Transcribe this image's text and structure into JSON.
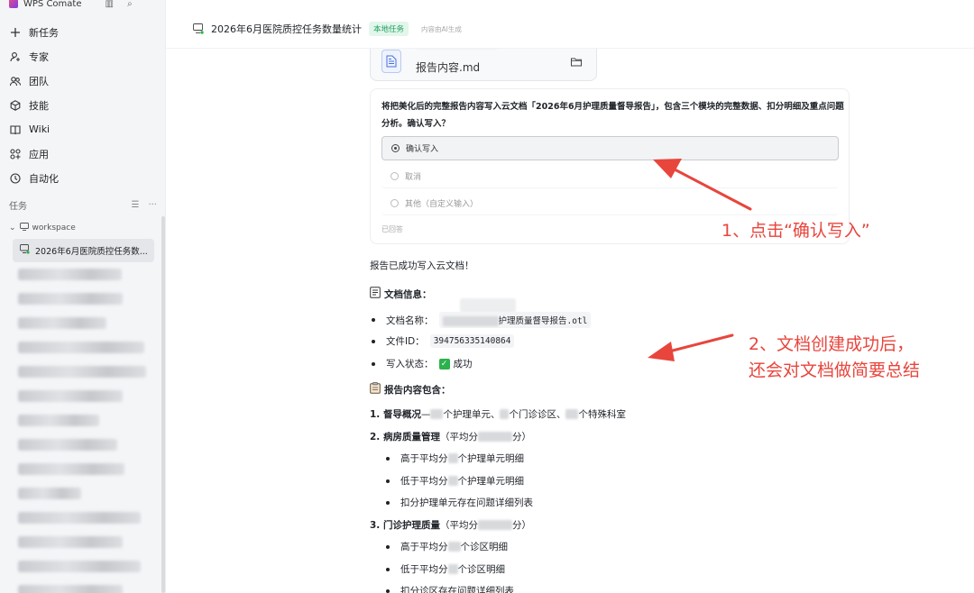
{
  "app": {
    "title": "WPS Comate"
  },
  "sidebar": {
    "nav": [
      {
        "icon": "plus-icon",
        "label": "新任务"
      },
      {
        "icon": "expert-icon",
        "label": "专家"
      },
      {
        "icon": "team-icon",
        "label": "团队"
      },
      {
        "icon": "skill-icon",
        "label": "技能"
      },
      {
        "icon": "wiki-icon",
        "label": "Wiki"
      },
      {
        "icon": "apps-icon",
        "label": "应用"
      },
      {
        "icon": "clock-icon",
        "label": "自动化"
      }
    ],
    "tasks_label": "任务",
    "workspace_label": "workspace",
    "active_task": "2026年6月医院质控任务数..."
  },
  "header": {
    "title": "2026年6月医院质控任务数量统计",
    "badge": "本地任务",
    "ai_note": "内容由AI生成"
  },
  "file_card": {
    "name": "报告内容.md"
  },
  "ask": {
    "question": "将把美化后的完整报告内容写入云文档「2026年6月护理质量督导报告」，包含三个模块的完整数据、扣分明细及重点问题分析。确认写入？",
    "options": [
      "确认写入",
      "取消",
      "其他（自定义输入）"
    ],
    "answered": "已回答"
  },
  "result": {
    "success": "报告已成功写入云文档！",
    "doc_info_title": "文档信息：",
    "doc_name_label": "文档名称：",
    "doc_name_value": "护理质量督导报告.otl",
    "file_id_label": "文件ID：",
    "file_id_value": "394756335140864",
    "status_label": "写入状态：",
    "status_value": "成功",
    "contains_title": "报告内容包含：",
    "item1_title": "1. 督导概况",
    "item1_text_a": " — ",
    "item1_text_b": "个护理单元、",
    "item1_text_c": "个门诊诊区、",
    "item1_text_d": "个特殊科室",
    "item2_title": "2. 病房质量管理",
    "item2_avg": "（平均分",
    "item2_avg_end": "分）",
    "item2_sub": [
      "高于平均分",
      "个护理单元明细",
      "低于平均分",
      "个护理单元明细",
      "扣分护理单元存在问题详细列表"
    ],
    "item3_title": "3. 门诊护理质量",
    "item3_avg": "（平均分",
    "item3_avg_end": "分）",
    "item3_sub": [
      "高于平均分",
      "个诊区明细",
      "低于平均分",
      "个诊区明细",
      "扣分诊区存在问题详细列表"
    ]
  },
  "annotations": {
    "a1": "1、点击“确认写入”",
    "a2_line1": "2、文档创建成功后，",
    "a2_line2": "还会对文档做简要总结"
  },
  "colors": {
    "annotation": "#e8453c",
    "badge": "#1a9e5a",
    "success": "#2bb24c"
  }
}
